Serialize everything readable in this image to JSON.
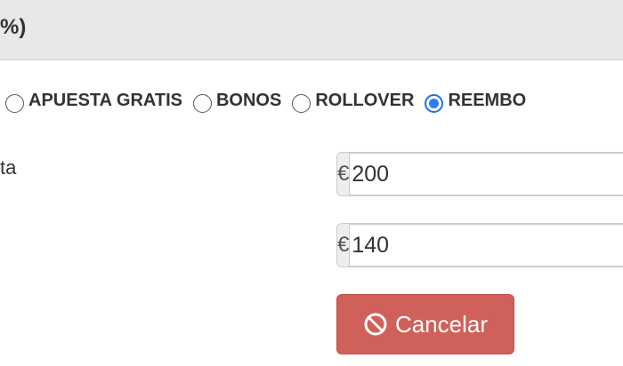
{
  "header": {
    "title": "%)"
  },
  "bet_types": {
    "options": [
      {
        "label": "APUESTA GRATIS",
        "checked": false
      },
      {
        "label": "BONOS",
        "checked": false
      },
      {
        "label": "ROLLOVER",
        "checked": false
      },
      {
        "label": "REEMBO",
        "checked": true
      }
    ]
  },
  "form": {
    "stake_label": "ta",
    "currency_symbol": "€",
    "stake_value": "200",
    "second_value": "140"
  },
  "actions": {
    "cancel_label": "Cancelar"
  },
  "colors": {
    "header_bg": "#e8e8e8",
    "radio_checked": "#2f7cf6",
    "cancel_bg": "#d0605a"
  },
  "icons": {
    "cancel": "ban-icon"
  }
}
